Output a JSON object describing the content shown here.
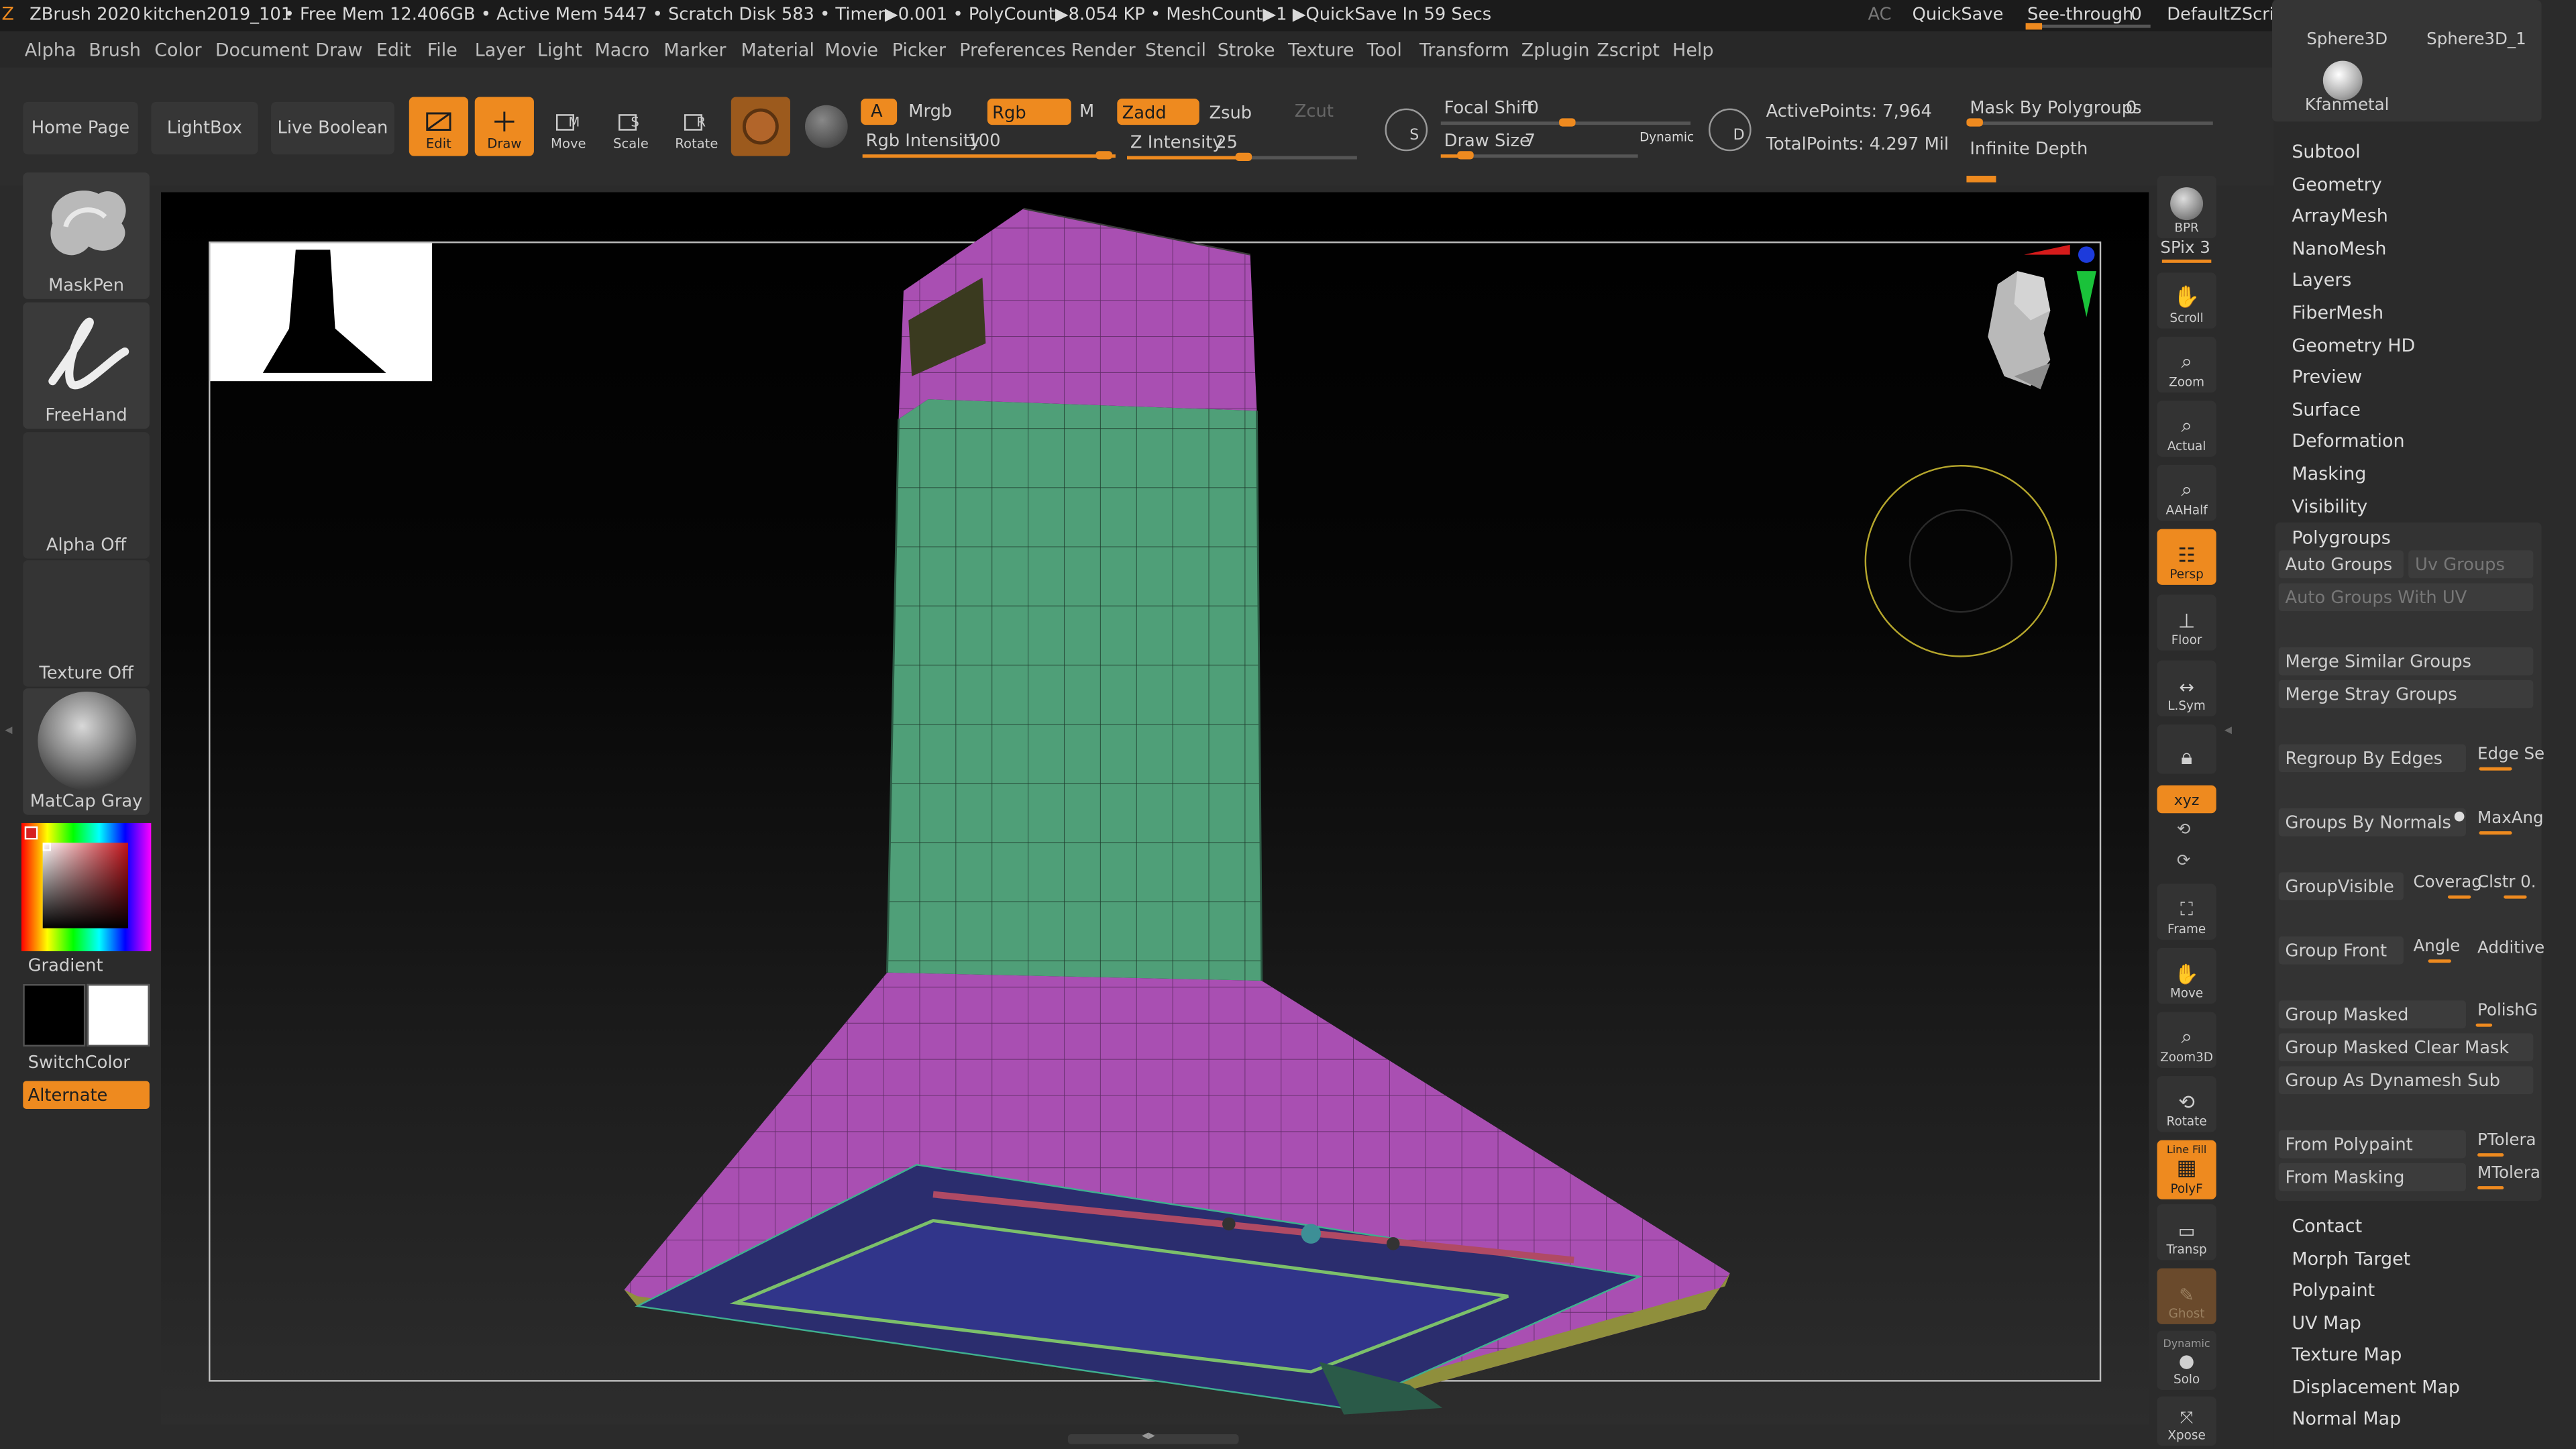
{
  "titlebar": {
    "app": "ZBrush 2020",
    "file": "kitchen2019_101",
    "stats": "• Free Mem 12.406GB • Active Mem 5447 • Scratch Disk 583 • Timer▶0.001 • PolyCount▶8.054 KP • MeshCount▶1 ▶QuickSave In 59 Secs",
    "ac": "AC",
    "quicksave": "QuickSave",
    "seethrough": "See-through",
    "seethrough_value": "0",
    "script": "DefaultZScript"
  },
  "menu": [
    "Alpha",
    "Brush",
    "Color",
    "Document",
    "Draw",
    "Edit",
    "File",
    "Layer",
    "Light",
    "Macro",
    "Marker",
    "Material",
    "Movie",
    "Picker",
    "Preferences",
    "Render",
    "Stencil",
    "Stroke",
    "Texture",
    "Tool",
    "Transform",
    "Zplugin",
    "Zscript",
    "Help"
  ],
  "toolbar": {
    "home": "Home Page",
    "lightbox": "LightBox",
    "liveboolean": "Live Boolean",
    "edit": "Edit",
    "draw": "Draw",
    "move": "Move",
    "scale": "Scale",
    "rotate": "Rotate",
    "a": "A",
    "mrgb": "Mrgb",
    "rgb": "Rgb",
    "m": "M",
    "zadd": "Zadd",
    "zsub": "Zsub",
    "zcut": "Zcut",
    "rgb_intensity_label": "Rgb Intensity",
    "rgb_intensity": "100",
    "z_intensity_label": "Z Intensity",
    "z_intensity": "25",
    "focal_label": "Focal Shift",
    "focal": "0",
    "drawsize_label": "Draw Size",
    "drawsize": "7",
    "dynamic": "Dynamic",
    "s": "S",
    "d": "D",
    "active_points": "ActivePoints: 7,964",
    "total_points": "TotalPoints: 4.297 Mil",
    "mask_polygroups_label": "Mask By Polygroups",
    "mask_polygroups": "0",
    "infinite_depth": "Infinite Depth"
  },
  "left": {
    "brush": "MaskPen",
    "stroke": "FreeHand",
    "alpha": "Alpha Off",
    "texture": "Texture Off",
    "material": "MatCap Gray",
    "gradient": "Gradient",
    "switchcolor": "SwitchColor",
    "alternate": "Alternate"
  },
  "right_tools": {
    "bpr": "BPR",
    "spix": "SPix 3",
    "scroll": "Scroll",
    "zoom": "Zoom",
    "actual": "Actual",
    "aahalf": "AAHalf",
    "persp": "Persp",
    "floor": "Floor",
    "lsym": "L.Sym",
    "xyz": "xyz",
    "frame": "Frame",
    "move": "Move",
    "zoom3d": "Zoom3D",
    "rotate": "Rotate",
    "linefill": "Line Fill",
    "polyf": "PolyF",
    "transp": "Transp",
    "ghost": "Ghost",
    "dynamic": "Dynamic",
    "solo": "Solo",
    "xpose": "Xpose"
  },
  "panel": {
    "thumb1": "Sphere3D",
    "thumb2": "Sphere3D_1",
    "thumb3": "Kfanmetal",
    "subtool": "Subtool",
    "geometry": "Geometry",
    "arraymesh": "ArrayMesh",
    "nanomesh": "NanoMesh",
    "layers": "Layers",
    "fibermesh": "FiberMesh",
    "geometryhd": "Geometry HD",
    "preview": "Preview",
    "surface": "Surface",
    "deformation": "Deformation",
    "masking": "Masking",
    "visibility": "Visibility",
    "polygroups": "Polygroups",
    "autogroups": "Auto Groups",
    "uvgroups": "Uv Groups",
    "autogroupsuv": "Auto Groups With UV",
    "mergesimilar": "Merge Similar Groups",
    "mergestray": "Merge Stray Groups",
    "regroupedges": "Regroup By Edges",
    "edgese": "Edge Se",
    "groupsnormals": "Groups By Normals",
    "maxang": "MaxAng",
    "groupvisible": "GroupVisible",
    "coverage": "Coverag",
    "clstr": "Clstr 0.",
    "groupfront": "Group Front",
    "angle": "Angle",
    "additive": "Additive",
    "groupmasked": "Group Masked",
    "polishg": "PolishG",
    "groupmaskedclear": "Group Masked Clear Mask",
    "groupdynamesh": "Group As Dynamesh Sub",
    "frompolypaint": "From Polypaint",
    "ptolera": "PTolera",
    "frommasking": "From Masking",
    "mtolera": "MTolera",
    "contact": "Contact",
    "morph": "Morph Target",
    "polypaint": "Polypaint",
    "uvmap": "UV Map",
    "texturemap": "Texture Map",
    "displacement": "Displacement Map",
    "normalmap": "Normal Map"
  },
  "colors": {
    "accent": "#ee8a1f",
    "polygroup_purple": "#a94fb2",
    "polygroup_green": "#4f9f78",
    "polygroup_blue": "#2b2d6e"
  }
}
